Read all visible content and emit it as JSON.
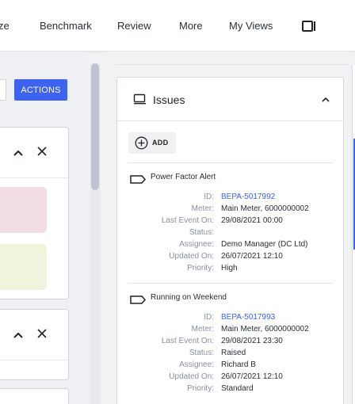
{
  "nav": {
    "items": [
      "ze",
      "Benchmark",
      "Review",
      "More",
      "My Views"
    ],
    "layout_icon": "panel-toggle-icon"
  },
  "left": {
    "actions_label": "ACTIONS"
  },
  "issues_panel": {
    "title": "Issues",
    "add_label": "ADD",
    "labels": {
      "id": "ID:",
      "meter": "Meter:",
      "last_event": "Last Event On:",
      "status": "Status:",
      "assignee": "Assignee:",
      "updated": "Updated On:",
      "priority": "Priority:"
    },
    "issues": [
      {
        "title": "Power Factor Alert",
        "id": "BEPA-5017992",
        "meter": "Main Meter, 6000000002",
        "last_event": "29/08/2021 00:00",
        "status": "",
        "assignee": "Demo Manager (DC Ltd)",
        "updated": "26/07/2021 12:10",
        "priority": "High"
      },
      {
        "title": "Running on Weekend",
        "id": "BEPA-5017993",
        "meter": "Main Meter, 6000000002",
        "last_event": "29/08/2021 23:30",
        "status": "Raised",
        "assignee": "Richard B",
        "updated": "26/07/2021 12:10",
        "priority": "Standard"
      }
    ]
  },
  "colors": {
    "accent": "#3d63f0",
    "tile_pink": "#f2dde5",
    "tile_green": "#eef5dc"
  }
}
